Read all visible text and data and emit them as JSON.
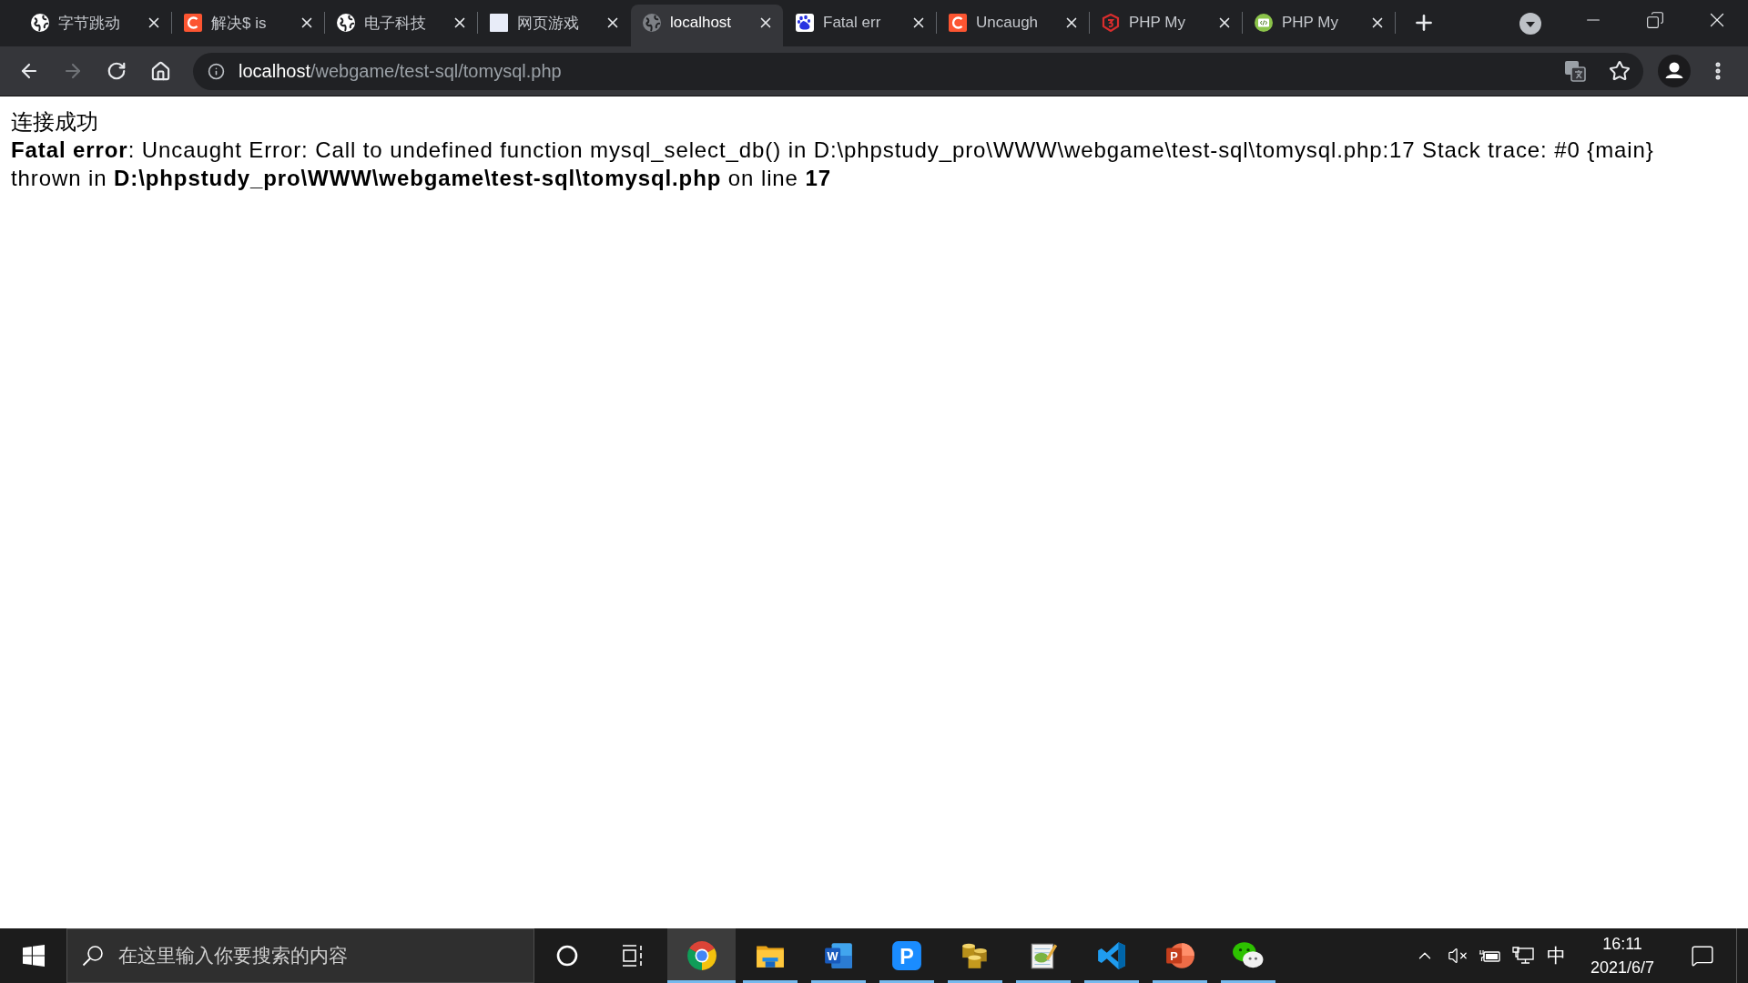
{
  "browser": {
    "tabs": [
      {
        "title": "字节跳动",
        "kind": "globe",
        "selected": false
      },
      {
        "title": "解决$ is",
        "kind": "arc",
        "selected": false
      },
      {
        "title": "电子科技",
        "kind": "globe",
        "selected": false
      },
      {
        "title": "网页游戏",
        "kind": "plain",
        "selected": false
      },
      {
        "title": "localhost",
        "kind": "dimglobe",
        "selected": true
      },
      {
        "title": "Fatal err",
        "kind": "paw",
        "selected": false
      },
      {
        "title": "Uncaugh",
        "kind": "arc",
        "selected": false
      },
      {
        "title": "PHP My",
        "kind": "shield",
        "selected": false
      },
      {
        "title": "PHP My",
        "kind": "code",
        "selected": false
      }
    ],
    "toolbar": {
      "back_disabled": false,
      "forward_disabled": true,
      "address": {
        "host": "localhost",
        "path": "/webgame/test-sql/tomysql.php"
      }
    }
  },
  "page": {
    "status": "连接成功",
    "error": "**Fatal error**: Uncaught Error: Call to undefined function mysql_select_db() in D:\\phpstudy_pro\\WWW\\webgame\\test-sql\\tomysql.php:17 Stack trace: #0 {main} thrown in **D:\\phpstudy_pro\\WWW\\webgame\\test-sql\\tomysql.php** on line **17**"
  },
  "taskbar": {
    "search": {
      "placeholder": "在这里输入你要搜索的内容"
    },
    "apps": [
      {
        "kind": "browser",
        "selected": true,
        "running": true
      },
      {
        "kind": "folder",
        "selected": false,
        "running": true
      },
      {
        "kind": "writer",
        "letter": "W",
        "selected": false,
        "running": true
      },
      {
        "kind": "publisher",
        "letter": "P",
        "selected": false,
        "running": true
      },
      {
        "kind": "coins",
        "selected": false,
        "running": true
      },
      {
        "kind": "editor",
        "selected": false,
        "running": true
      },
      {
        "kind": "code",
        "selected": false,
        "running": true
      },
      {
        "kind": "slides",
        "letter": "P",
        "selected": false,
        "running": true
      },
      {
        "kind": "chat",
        "selected": false,
        "running": true
      }
    ],
    "tray": {
      "ime": "中",
      "time": "16:11",
      "date": "2021/6/7"
    }
  }
}
